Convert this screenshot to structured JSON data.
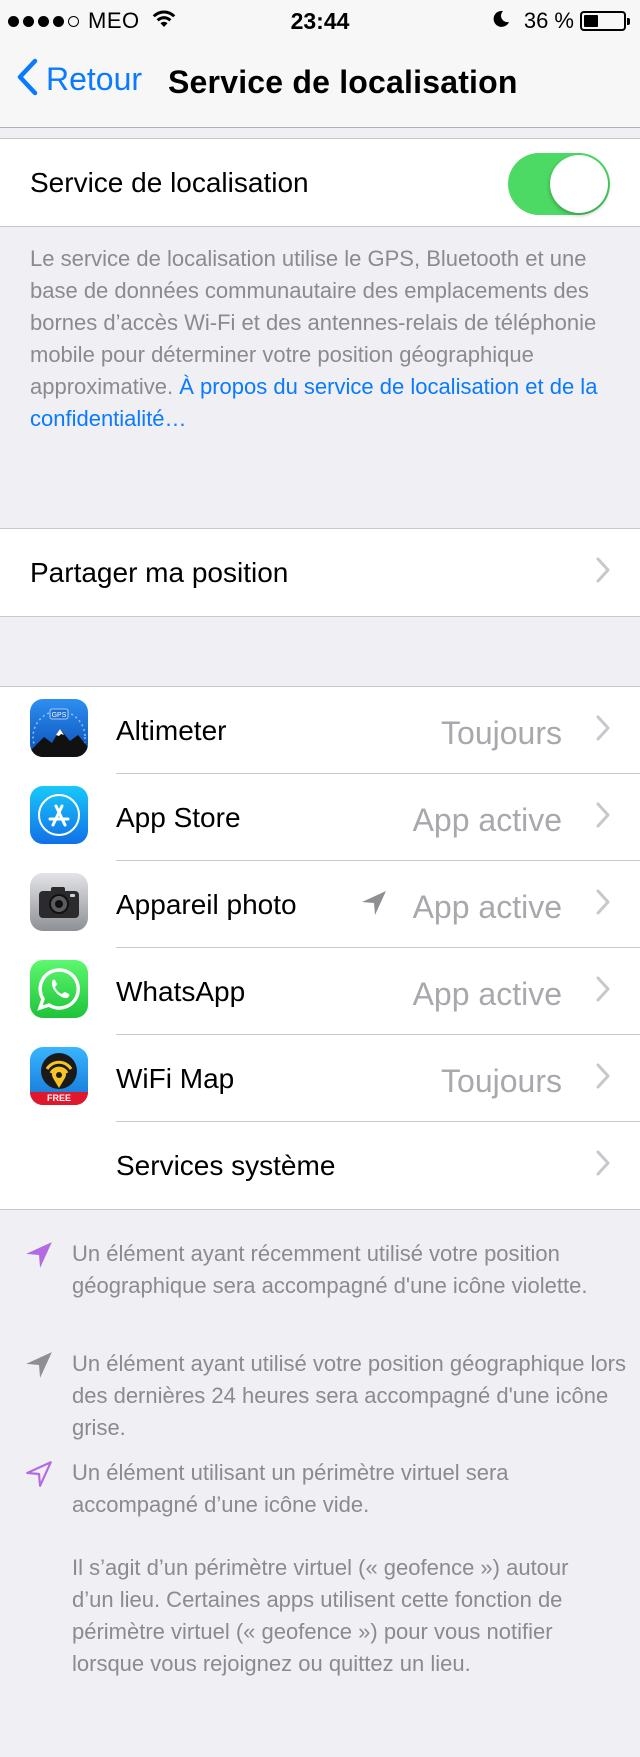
{
  "status": {
    "carrier": "MEO",
    "time": "23:44",
    "battery_percent": "36 %",
    "battery_level": 0.36
  },
  "nav": {
    "back_label": "Retour",
    "title": "Service de localisation"
  },
  "location_toggle": {
    "label": "Service de localisation",
    "on": true,
    "color": "#4cd964"
  },
  "description": {
    "text": "Le service de localisation utilise le GPS, Bluetooth et une base de données communautaire des emplacements des bornes d’accès Wi-Fi et des antennes-relais de téléphonie mobile pour déterminer votre position géographique approximative. ",
    "link": "À propos du service de localisation et de la confidentialité…"
  },
  "share": {
    "label": "Partager ma position"
  },
  "apps": [
    {
      "name": "Altimeter",
      "value": "Toujours",
      "icon": "altimeter-icon",
      "location_arrow": false
    },
    {
      "name": "App Store",
      "value": "App active",
      "icon": "app-store-icon",
      "location_arrow": false
    },
    {
      "name": "Appareil photo",
      "value": "App active",
      "icon": "camera-icon",
      "location_arrow": true
    },
    {
      "name": "WhatsApp",
      "value": "App active",
      "icon": "whatsapp-icon",
      "location_arrow": false
    },
    {
      "name": "WiFi Map",
      "value": "Toujours",
      "icon": "wifi-map-icon",
      "location_arrow": false,
      "badge": "FREE"
    }
  ],
  "system_services": {
    "label": "Services système"
  },
  "legend": [
    {
      "icon": "purple-arrow-icon",
      "text": "Un élément ayant récemment utilisé votre position géographique sera accompagné d'une icône violette."
    },
    {
      "icon": "gray-arrow-icon",
      "text": "Un élément ayant utilisé votre position géographique lors des dernières 24 heures sera accompagné d'une icône grise."
    },
    {
      "icon": "outline-arrow-icon",
      "text": "Un élément utilisant un périmètre virtuel sera accompagné d’une icône vide."
    }
  ],
  "geofence_note": "Il s’agit d’un périmètre virtuel (« geofence ») autour d’un lieu. Certaines apps utilisent cette fonction de périmètre virtuel (« geofence ») pour vous notifier lorsque vous rejoignez ou quittez un lieu.",
  "colors": {
    "accent": "#0a7aff",
    "toggle_on": "#4cd964",
    "recent_location": "#b36ae2",
    "past_location": "#8e8e93"
  }
}
